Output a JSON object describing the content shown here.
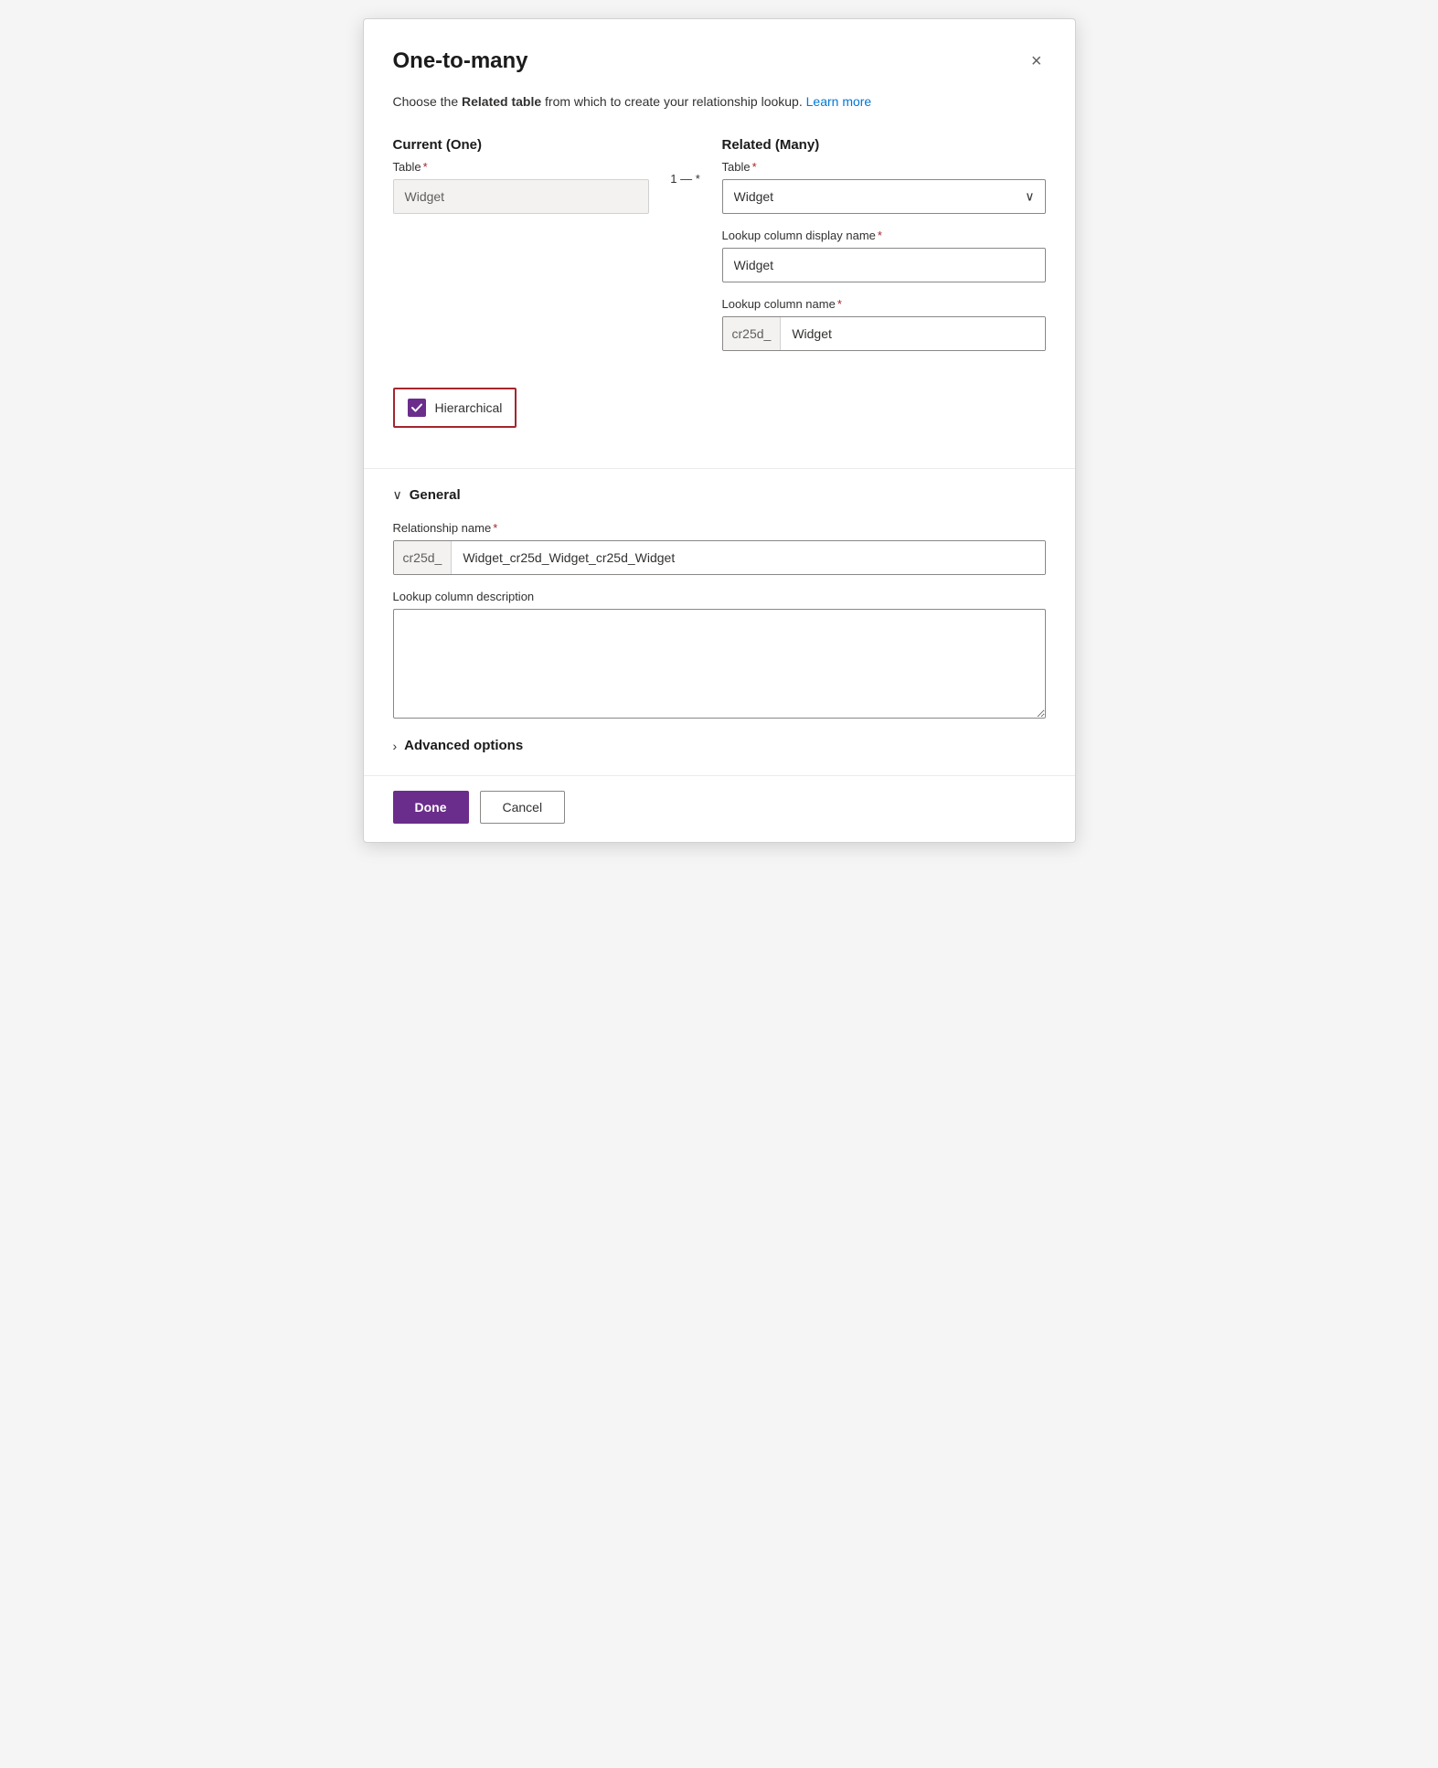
{
  "dialog": {
    "title": "One-to-many",
    "close_label": "×",
    "description_text": "Choose the ",
    "description_bold": "Related table",
    "description_after": " from which to create your relationship lookup.",
    "learn_more_label": "Learn more",
    "learn_more_url": "#"
  },
  "current_section": {
    "column_label": "Current (One)",
    "table_label": "Table",
    "required_indicator": "*",
    "table_value": "Widget"
  },
  "connector": {
    "text": "1 — *"
  },
  "related_section": {
    "column_label": "Related (Many)",
    "table_label": "Table",
    "required_indicator": "*",
    "table_selected": "Widget",
    "table_options": [
      "Widget"
    ],
    "lookup_display_label": "Lookup column display name",
    "lookup_display_required": "*",
    "lookup_display_value": "Widget",
    "lookup_name_label": "Lookup column name",
    "lookup_name_required": "*",
    "lookup_name_prefix": "cr25d_",
    "lookup_name_value": "Widget"
  },
  "hierarchical": {
    "label": "Hierarchical",
    "checked": true
  },
  "general_section": {
    "header_label": "General",
    "chevron": "∨",
    "relationship_name_label": "Relationship name",
    "relationship_name_required": "*",
    "relationship_name_prefix": "cr25d_",
    "relationship_name_value": "Widget_cr25d_Widget_cr25d_Widget",
    "description_label": "Lookup column description",
    "description_value": ""
  },
  "advanced_section": {
    "header_label": "Advanced options",
    "chevron": "›"
  },
  "footer": {
    "done_label": "Done",
    "cancel_label": "Cancel"
  }
}
